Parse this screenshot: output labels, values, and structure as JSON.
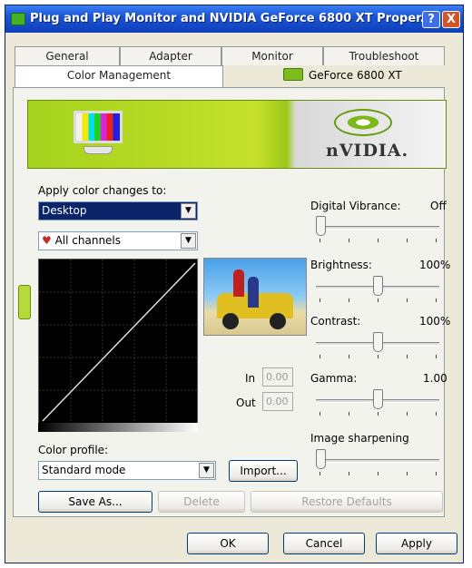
{
  "window": {
    "title": "Plug and Play Monitor and NVIDIA GeForce 6800 XT Proper...",
    "help_label": "?",
    "close_label": "X"
  },
  "tabs_row1": [
    "General",
    "Adapter",
    "Monitor",
    "Troubleshoot"
  ],
  "tabs_row2": {
    "active": "Color Management",
    "gpu_name": "GeForce 6800 XT"
  },
  "banner": {
    "brand": "nVIDIA."
  },
  "color": {
    "apply_label": "Apply color changes to:",
    "target_value": "Desktop",
    "channel_value": "All channels",
    "in_label": "In",
    "in_value": "0.00",
    "out_label": "Out",
    "out_value": "0.00",
    "profile_label": "Color profile:",
    "profile_value": "Standard mode",
    "import_label": "Import...",
    "save_as_label": "Save As...",
    "delete_label": "Delete",
    "restore_label": "Restore Defaults"
  },
  "sliders": {
    "digital_vibrance": {
      "label": "Digital Vibrance:",
      "value": "Off",
      "level": 0.0
    },
    "brightness": {
      "label": "Brightness:",
      "value": "100%",
      "level": 0.5
    },
    "contrast": {
      "label": "Contrast:",
      "value": "100%",
      "level": 0.5
    },
    "gamma": {
      "label": "Gamma:",
      "value": "1.00",
      "level": 0.5
    },
    "image_sharpening": {
      "label": "Image sharpening",
      "value": "",
      "level": 0.0
    }
  },
  "dialog_buttons": {
    "ok": "OK",
    "cancel": "Cancel",
    "apply": "Apply"
  },
  "colors": {
    "titlebar": "#1b55d6",
    "nvidia_green": "#a4d21d",
    "dialog_bg": "#ece9d8"
  }
}
